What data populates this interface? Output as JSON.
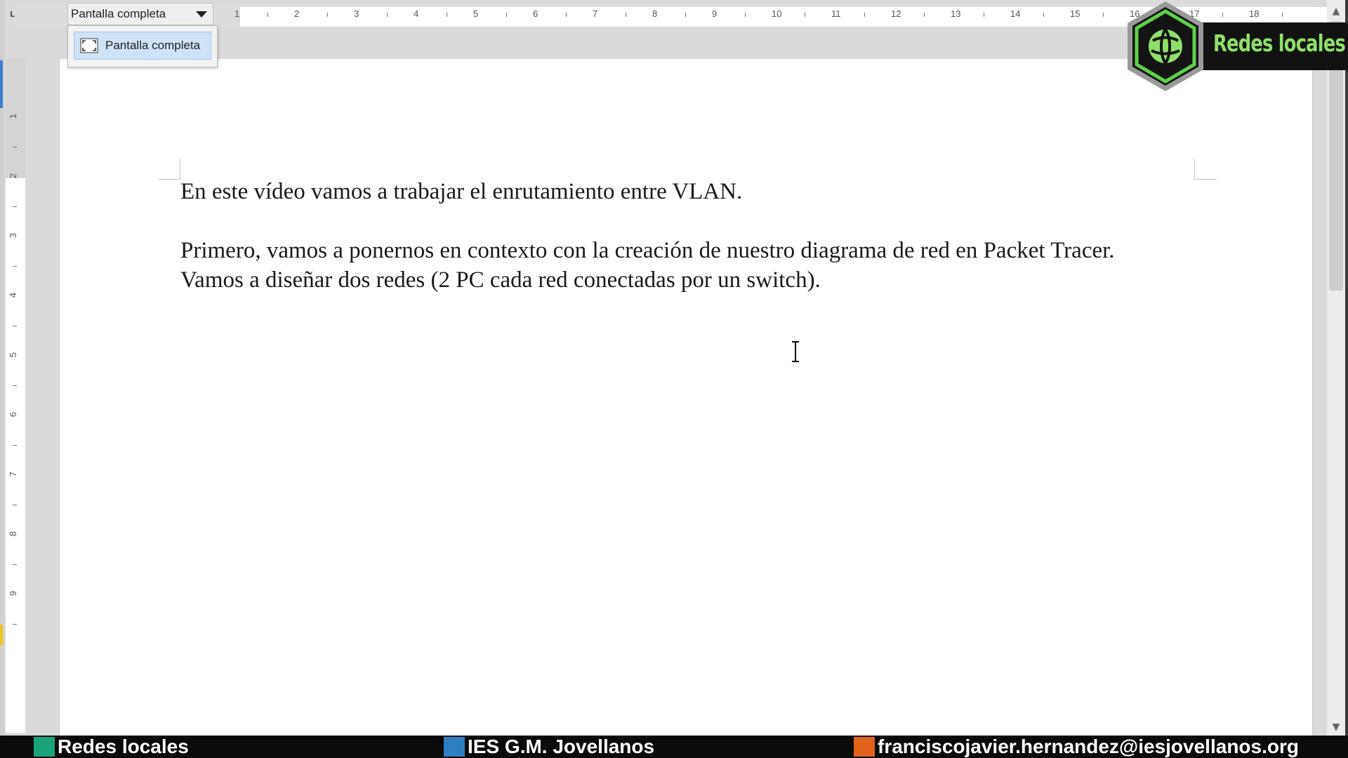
{
  "toolbar": {
    "zoom_value": "Pantalla completa",
    "zoom_options": [
      "Pantalla completa"
    ]
  },
  "ruler": {
    "h_numbers": [
      "1",
      "2",
      "3",
      "4",
      "5",
      "6",
      "7",
      "8",
      "9",
      "10",
      "11",
      "12",
      "13",
      "14",
      "15",
      "16",
      "17",
      "18"
    ],
    "v_numbers": [
      "1",
      "2",
      "3",
      "4",
      "5",
      "6",
      "7",
      "8",
      "9"
    ]
  },
  "document": {
    "paragraph_1": "En este vídeo vamos a trabajar el enrutamiento entre VLAN.",
    "paragraph_2": "Primero, vamos a ponernos en contexto con la creación de nuestro diagrama de red en Packet Tracer. Vamos a diseñar dos redes (2 PC cada red conectadas por un switch)."
  },
  "logo": {
    "text": "Redes locales",
    "color": "#8ee06a"
  },
  "footer": {
    "items": [
      {
        "label": "Redes locales",
        "color": "#1aa37a"
      },
      {
        "label": "IES G.M. Jovellanos",
        "color": "#2d7fc1"
      },
      {
        "label": "franciscojavier.hernandez@iesjovellanos.org",
        "color": "#e2621c"
      }
    ]
  }
}
